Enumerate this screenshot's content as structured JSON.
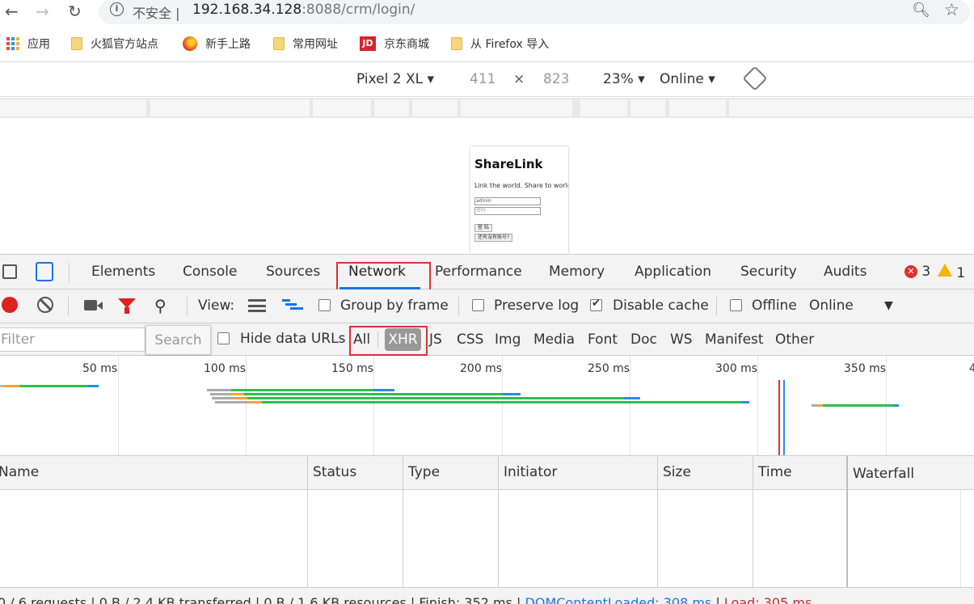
{
  "browser": {
    "security_label": "不安全",
    "url_host": "192.168.34.128",
    "url_rest": ":8088/crm/login/",
    "bookmarks": [
      {
        "label": "应用",
        "icon": "apps-grid-icon"
      },
      {
        "label": "火狐官方站点",
        "icon": "folder-icon"
      },
      {
        "label": "新手上路",
        "icon": "firefox-icon"
      },
      {
        "label": "常用网址",
        "icon": "folder-icon"
      },
      {
        "label": "京东商城",
        "icon": "jd-icon"
      },
      {
        "label": "从 Firefox 导入",
        "icon": "folder-icon"
      }
    ]
  },
  "device_toolbar": {
    "device": "Pixel 2 XL",
    "width": "411",
    "times": "×",
    "height": "823",
    "zoom": "23%",
    "network": "Online"
  },
  "device_page": {
    "title": "ShareLink",
    "subtitle": "Link the world. Share to world",
    "username_value": "admin",
    "password_placeholder": "密码",
    "login_button": "登 陆",
    "register_button": "还有没有账号?"
  },
  "devtools": {
    "tabs": [
      "Elements",
      "Console",
      "Sources",
      "Network",
      "Performance",
      "Memory",
      "Application",
      "Security",
      "Audits"
    ],
    "active_tab": "Network",
    "error_count": "3",
    "warning_count": "1"
  },
  "network_toolbar": {
    "view_label": "View:",
    "group_by_frame": "Group by frame",
    "preserve_log": "Preserve log",
    "disable_cache": "Disable cache",
    "offline": "Offline",
    "throttle": "Online"
  },
  "filter_bar": {
    "filter_placeholder": "Filter",
    "search_button": "Search",
    "hide_data_urls": "Hide data URLs",
    "types": [
      "All",
      "XHR",
      "JS",
      "CSS",
      "Img",
      "Media",
      "Font",
      "Doc",
      "WS",
      "Manifest",
      "Other"
    ],
    "active_type": "XHR"
  },
  "timeline": {
    "ticks": [
      "50 ms",
      "100 ms",
      "150 ms",
      "200 ms",
      "250 ms",
      "300 ms",
      "350 ms",
      "4"
    ]
  },
  "table": {
    "columns": [
      "Name",
      "Status",
      "Type",
      "Initiator",
      "Size",
      "Time",
      "Waterfall"
    ]
  },
  "summary": {
    "requests": "0 / 6 requests",
    "transferred": "0 B / 2.4 KB transferred",
    "resources": "0 B / 1.6 KB resources",
    "finish": "Finish: 352 ms",
    "dom_content_loaded": "DOMContentLoaded: 308 ms",
    "load": "Load: 305 ms",
    "sep": "|"
  },
  "colors": {
    "accent": "#1a73e8",
    "highlight_box": "#e03030",
    "record": "#e0201c",
    "bar_green": "#2ebd4f",
    "bar_blue": "#2b8ae6",
    "bar_orange": "#f2a33a"
  }
}
